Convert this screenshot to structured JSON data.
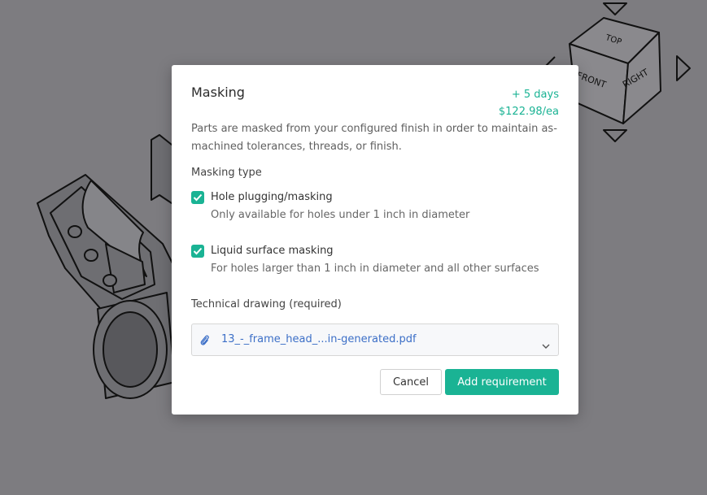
{
  "viewcube": {
    "faces": {
      "top": "TOP",
      "front": "FRONT",
      "right": "RIGHT"
    }
  },
  "modal": {
    "title": "Masking",
    "lead_time": "+ 5 days",
    "price": "$122.98/ea",
    "description": "Parts are masked from your configured finish in order to maintain as-machined tolerances, threads, or finish.",
    "masking_type_label": "Masking type",
    "options": [
      {
        "label": "Hole plugging/masking",
        "sublabel": "Only available for holes under 1 inch in diameter",
        "checked": true
      },
      {
        "label": "Liquid surface masking",
        "sublabel": "For holes larger than 1 inch in diameter and all other surfaces",
        "checked": true
      }
    ],
    "drawing_label": "Technical drawing (required)",
    "drawing_file": "13_-_frame_head_...in-generated.pdf",
    "cancel_label": "Cancel",
    "add_label": "Add requirement"
  },
  "colors": {
    "accent": "#1ab394",
    "link": "#3c6fc7",
    "backdrop": "#7d7c80"
  }
}
